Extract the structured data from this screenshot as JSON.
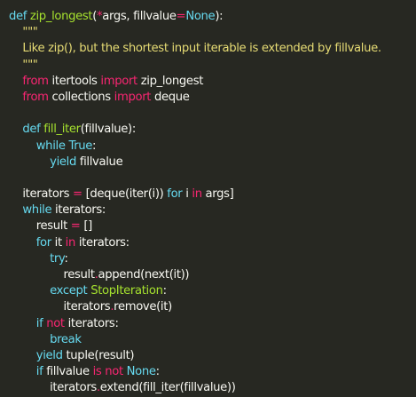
{
  "colors": {
    "background": "#272822",
    "keyword": "#66d9ef",
    "function_name": "#a6e22e",
    "operator": "#f92672",
    "constant": "#ae81ff",
    "docstring": "#e6db74",
    "text": "#f8f8f2"
  },
  "code": {
    "lines": [
      [
        {
          "t": "def",
          "c": "keyword"
        },
        {
          "t": " ",
          "c": "text"
        },
        {
          "t": "zip_longest",
          "c": "function_name"
        },
        {
          "t": "(",
          "c": "text"
        },
        {
          "t": "*",
          "c": "operator"
        },
        {
          "t": "args, fillvalue",
          "c": "text"
        },
        {
          "t": "=",
          "c": "operator"
        },
        {
          "t": "None",
          "c": "keyword"
        },
        {
          "t": "):",
          "c": "text"
        }
      ],
      [
        {
          "t": "    \"\"\"",
          "c": "docstring"
        }
      ],
      [
        {
          "t": "    Like zip(), but the shortest input iterable is extended by fillvalue.",
          "c": "docstring"
        }
      ],
      [
        {
          "t": "    \"\"\"",
          "c": "docstring"
        }
      ],
      [
        {
          "t": "    ",
          "c": "text"
        },
        {
          "t": "from",
          "c": "operator"
        },
        {
          "t": " itertools ",
          "c": "text"
        },
        {
          "t": "import",
          "c": "operator"
        },
        {
          "t": " zip_longest",
          "c": "text"
        }
      ],
      [
        {
          "t": "    ",
          "c": "text"
        },
        {
          "t": "from",
          "c": "operator"
        },
        {
          "t": " collections ",
          "c": "text"
        },
        {
          "t": "import",
          "c": "operator"
        },
        {
          "t": " deque",
          "c": "text"
        }
      ],
      [
        {
          "t": "",
          "c": "text"
        }
      ],
      [
        {
          "t": "    ",
          "c": "text"
        },
        {
          "t": "def",
          "c": "keyword"
        },
        {
          "t": " ",
          "c": "text"
        },
        {
          "t": "fill_iter",
          "c": "function_name"
        },
        {
          "t": "(fillvalue):",
          "c": "text"
        }
      ],
      [
        {
          "t": "        ",
          "c": "text"
        },
        {
          "t": "while",
          "c": "keyword"
        },
        {
          "t": " ",
          "c": "text"
        },
        {
          "t": "True",
          "c": "keyword"
        },
        {
          "t": ":",
          "c": "text"
        }
      ],
      [
        {
          "t": "            ",
          "c": "text"
        },
        {
          "t": "yield",
          "c": "keyword"
        },
        {
          "t": " fillvalue",
          "c": "text"
        }
      ],
      [
        {
          "t": "",
          "c": "text"
        }
      ],
      [
        {
          "t": "    iterators ",
          "c": "text"
        },
        {
          "t": "=",
          "c": "operator"
        },
        {
          "t": " [deque(iter(i)) ",
          "c": "text"
        },
        {
          "t": "for",
          "c": "keyword"
        },
        {
          "t": " i ",
          "c": "text"
        },
        {
          "t": "in",
          "c": "operator"
        },
        {
          "t": " args]",
          "c": "text"
        }
      ],
      [
        {
          "t": "    ",
          "c": "text"
        },
        {
          "t": "while",
          "c": "keyword"
        },
        {
          "t": " iterators:",
          "c": "text"
        }
      ],
      [
        {
          "t": "        result ",
          "c": "text"
        },
        {
          "t": "=",
          "c": "operator"
        },
        {
          "t": " []",
          "c": "text"
        }
      ],
      [
        {
          "t": "        ",
          "c": "text"
        },
        {
          "t": "for",
          "c": "keyword"
        },
        {
          "t": " it ",
          "c": "text"
        },
        {
          "t": "in",
          "c": "operator"
        },
        {
          "t": " iterators:",
          "c": "text"
        }
      ],
      [
        {
          "t": "            ",
          "c": "text"
        },
        {
          "t": "try",
          "c": "keyword"
        },
        {
          "t": ":",
          "c": "text"
        }
      ],
      [
        {
          "t": "                result",
          "c": "text"
        },
        {
          "t": ".",
          "c": "operator"
        },
        {
          "t": "append(next(it))",
          "c": "text"
        }
      ],
      [
        {
          "t": "            ",
          "c": "text"
        },
        {
          "t": "except",
          "c": "keyword"
        },
        {
          "t": " ",
          "c": "text"
        },
        {
          "t": "StopIteration",
          "c": "function_name"
        },
        {
          "t": ":",
          "c": "text"
        }
      ],
      [
        {
          "t": "                iterators",
          "c": "text"
        },
        {
          "t": ".",
          "c": "operator"
        },
        {
          "t": "remove(it)",
          "c": "text"
        }
      ],
      [
        {
          "t": "        ",
          "c": "text"
        },
        {
          "t": "if",
          "c": "keyword"
        },
        {
          "t": " ",
          "c": "text"
        },
        {
          "t": "not",
          "c": "operator"
        },
        {
          "t": " iterators:",
          "c": "text"
        }
      ],
      [
        {
          "t": "            ",
          "c": "text"
        },
        {
          "t": "break",
          "c": "keyword"
        }
      ],
      [
        {
          "t": "        ",
          "c": "text"
        },
        {
          "t": "yield",
          "c": "keyword"
        },
        {
          "t": " tuple(result)",
          "c": "text"
        }
      ],
      [
        {
          "t": "        ",
          "c": "text"
        },
        {
          "t": "if",
          "c": "keyword"
        },
        {
          "t": " fillvalue ",
          "c": "text"
        },
        {
          "t": "is",
          "c": "operator"
        },
        {
          "t": " ",
          "c": "text"
        },
        {
          "t": "not",
          "c": "operator"
        },
        {
          "t": " ",
          "c": "text"
        },
        {
          "t": "None",
          "c": "keyword"
        },
        {
          "t": ":",
          "c": "text"
        }
      ],
      [
        {
          "t": "            iterators",
          "c": "text"
        },
        {
          "t": ".",
          "c": "operator"
        },
        {
          "t": "extend(fill_iter(fillvalue))",
          "c": "text"
        }
      ]
    ]
  }
}
